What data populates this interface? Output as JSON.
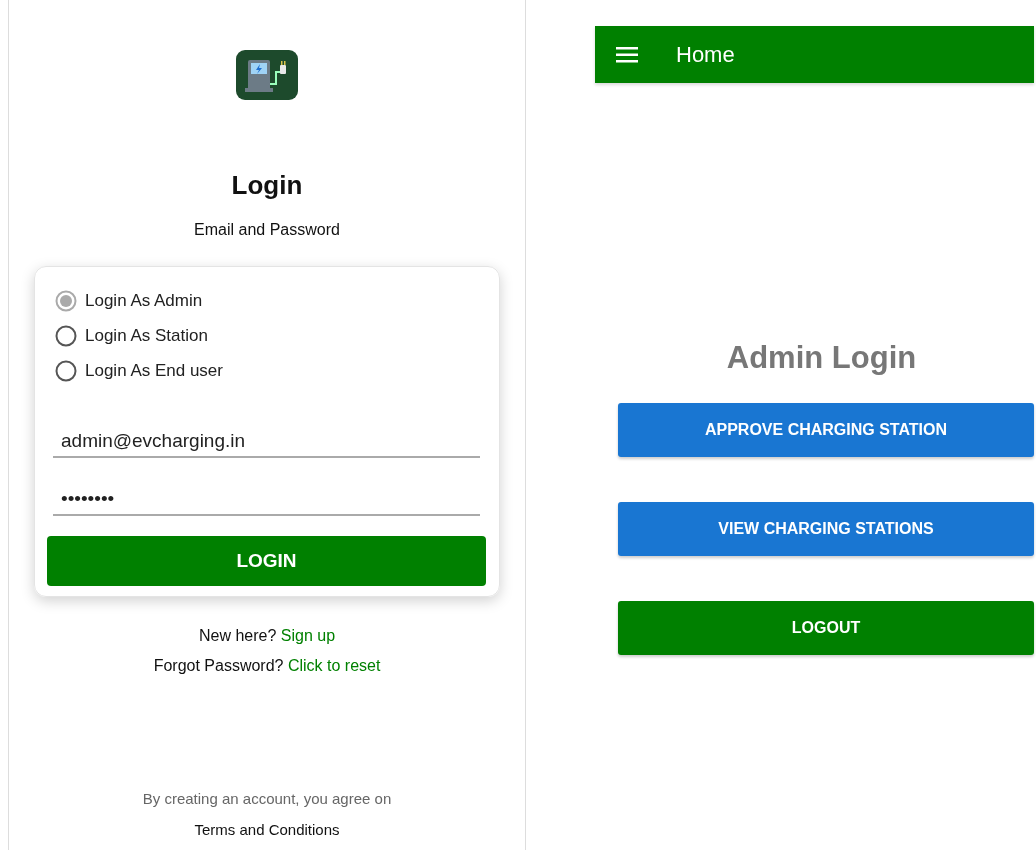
{
  "login_screen": {
    "title": "Login",
    "subtitle": "Email and Password",
    "roles": [
      {
        "label": "Login As Admin",
        "selected": true
      },
      {
        "label": "Login As Station",
        "selected": false
      },
      {
        "label": "Login As End user",
        "selected": false
      }
    ],
    "email_field": {
      "value": "admin@evcharging.in"
    },
    "password_field": {
      "value": "••••••••"
    },
    "login_button": "LOGIN",
    "prompts": [
      {
        "text": "New here?",
        "link": "Sign up"
      },
      {
        "text": "Forgot Password?",
        "link": "Click to reset"
      }
    ],
    "footer": {
      "notice": "By creating an account, you agree on",
      "terms": "Terms and Conditions"
    }
  },
  "home_screen": {
    "app_bar": {
      "title": "Home"
    },
    "heading": "Admin Login",
    "buttons": [
      {
        "label": "APPROVE CHARGING STATION",
        "color": "#1976d2"
      },
      {
        "label": "VIEW CHARGING STATIONS",
        "color": "#1976d2"
      },
      {
        "label": "LOGOUT",
        "color": "#008000"
      }
    ]
  }
}
